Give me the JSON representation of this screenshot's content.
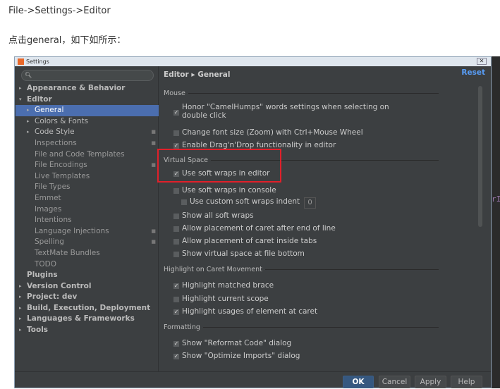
{
  "blog": {
    "line1": "File->Settings->Editor",
    "line2": "点击general，如下如所示："
  },
  "dialog": {
    "title": "Settings",
    "close": "✕",
    "search_placeholder": "",
    "tree": [
      {
        "label": "Appearance & Behavior",
        "level": 0,
        "bold": true,
        "arrow": "▸"
      },
      {
        "label": "Editor",
        "level": 0,
        "bold": true,
        "arrow": "▾"
      },
      {
        "label": "General",
        "level": 1,
        "arrow": "▸",
        "selected": true
      },
      {
        "label": "Colors & Fonts",
        "level": 1,
        "arrow": "▸"
      },
      {
        "label": "Code Style",
        "level": 1,
        "arrow": "▸",
        "copy": true
      },
      {
        "label": "Inspections",
        "level": 1,
        "copy": true
      },
      {
        "label": "File and Code Templates",
        "level": 1
      },
      {
        "label": "File Encodings",
        "level": 1,
        "copy": true
      },
      {
        "label": "Live Templates",
        "level": 1
      },
      {
        "label": "File Types",
        "level": 1
      },
      {
        "label": "Emmet",
        "level": 1
      },
      {
        "label": "Images",
        "level": 1
      },
      {
        "label": "Intentions",
        "level": 1
      },
      {
        "label": "Language Injections",
        "level": 1,
        "copy": true
      },
      {
        "label": "Spelling",
        "level": 1,
        "copy": true
      },
      {
        "label": "TextMate Bundles",
        "level": 1
      },
      {
        "label": "TODO",
        "level": 1
      },
      {
        "label": "Plugins",
        "level": 0,
        "bold": true
      },
      {
        "label": "Version Control",
        "level": 0,
        "bold": true,
        "arrow": "▸"
      },
      {
        "label": "Project: dev",
        "level": 0,
        "bold": true,
        "arrow": "▸"
      },
      {
        "label": "Build, Execution, Deployment",
        "level": 0,
        "bold": true,
        "arrow": "▸"
      },
      {
        "label": "Languages & Frameworks",
        "level": 0,
        "bold": true,
        "arrow": "▸"
      },
      {
        "label": "Tools",
        "level": 0,
        "bold": true,
        "arrow": "▸"
      }
    ],
    "breadcrumb": "Editor ▸ General",
    "reset": "Reset",
    "sections": {
      "mouse": "Mouse",
      "virtual": "Virtual Space",
      "highlight": "Highlight on Caret Movement",
      "formatting": "Formatting"
    },
    "options": [
      {
        "label": "Honor \"CamelHumps\" words settings when selecting on",
        "label2": "double click",
        "checked": true
      },
      {
        "label": "Change font size (Zoom) with Ctrl+Mouse Wheel",
        "checked": false
      },
      {
        "label": "Enable Drag'n'Drop functionality in editor",
        "checked": true
      },
      {
        "label": "Use soft wraps in editor",
        "checked": true
      },
      {
        "label": "Use soft wraps in console",
        "checked": false
      },
      {
        "label": "Use custom soft wraps indent",
        "checked": false,
        "value": "0"
      },
      {
        "label": "Show all soft wraps",
        "checked": false
      },
      {
        "label": "Allow placement of caret after end of line",
        "checked": false
      },
      {
        "label": "Allow placement of caret inside tabs",
        "checked": false
      },
      {
        "label": "Show virtual space at file bottom",
        "checked": false
      },
      {
        "label": "Highlight matched brace",
        "checked": true
      },
      {
        "label": "Highlight current scope",
        "checked": false
      },
      {
        "label": "Highlight usages of element at caret",
        "checked": true
      },
      {
        "label": "Show \"Reformat Code\" dialog",
        "checked": true
      },
      {
        "label": "Show \"Optimize Imports\" dialog",
        "checked": true
      }
    ],
    "buttons": {
      "ok": "OK",
      "cancel": "Cancel",
      "apply": "Apply",
      "help": "Help"
    }
  },
  "background_code": "rI",
  "colors": {
    "selection": "#4b6eaf",
    "highlight_box": "#e0202a",
    "link": "#589df6"
  }
}
